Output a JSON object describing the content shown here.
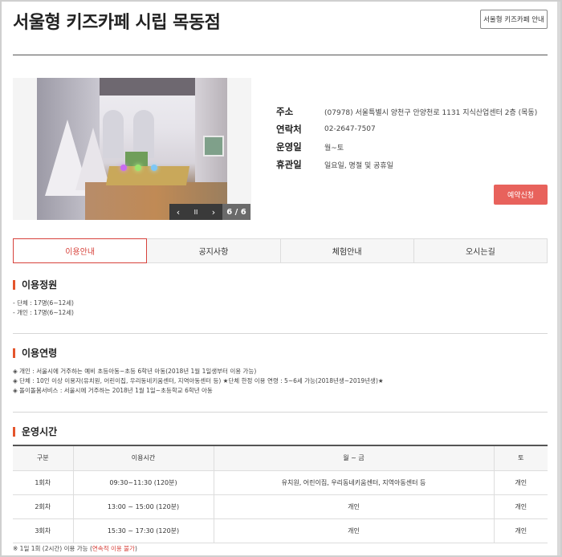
{
  "header": {
    "title": "서울형 키즈카페 시립 목동점",
    "info_button": "서울형 키즈카페 안내"
  },
  "gallery": {
    "counter": "6 / 6",
    "prev_icon": "‹",
    "pause_icon": "II",
    "next_icon": "›"
  },
  "info": {
    "address_label": "주소",
    "address_value": "(07978) 서울특별시 양천구 안양천로 1131 지식산업센터 2층 (목동)",
    "phone_label": "연락처",
    "phone_value": "02-2647-7507",
    "open_label": "운영일",
    "open_value": "월~토",
    "closed_label": "휴관일",
    "closed_value": "일요일, 명절 및 공휴일",
    "reserve_button": "예약신청"
  },
  "tabs": [
    {
      "label": "이용안내",
      "active": true
    },
    {
      "label": "공지사항",
      "active": false
    },
    {
      "label": "체험안내",
      "active": false
    },
    {
      "label": "오시는길",
      "active": false
    }
  ],
  "capacity": {
    "heading": "이용정원",
    "lines": [
      "- 단체 : 17명(6~12세)",
      "- 개인 : 17명(6~12세)"
    ]
  },
  "age": {
    "heading": "이용연령",
    "lines": [
      "◈ 개인 : 서울시에 거주하는 예비 초등아동~초등 6학년 아동(2018년 1월 1일생부터 이용 가능)",
      "◈ 단체 : 10인 이상 이용자(유치원, 어린이집, 우리동네키움센터, 지역아동센터 등) ★단체 한정 이용 연령 : 5~6세 가능(2018년생~2019년생)★",
      "◈ 돌이돌봄서비스 : 서울시에 거주하는 2018년 1월 1일~초등학교 6학년 아동"
    ]
  },
  "hours": {
    "heading": "운영시간",
    "columns": [
      "구분",
      "이용시간",
      "월 ~ 금",
      "토"
    ],
    "rows": [
      [
        "1회차",
        "09:30~11:30 (120분)",
        "유치원, 어린이집, 우리동네키움센터, 지역아동센터 등",
        "개인"
      ],
      [
        "2회차",
        "13:00 ~ 15:00 (120분)",
        "개인",
        "개인"
      ],
      [
        "3회차",
        "15:30 ~ 17:30 (120분)",
        "개인",
        "개인"
      ]
    ],
    "note_prefix": "※ 1일 1회 (2시간) 이용 가능 (",
    "note_red": "연속적 이용 불가",
    "note_suffix": ")"
  },
  "colors": {
    "accent": "#d7423b",
    "reserve": "#e8625c",
    "heading_bar": "#e4552c"
  }
}
